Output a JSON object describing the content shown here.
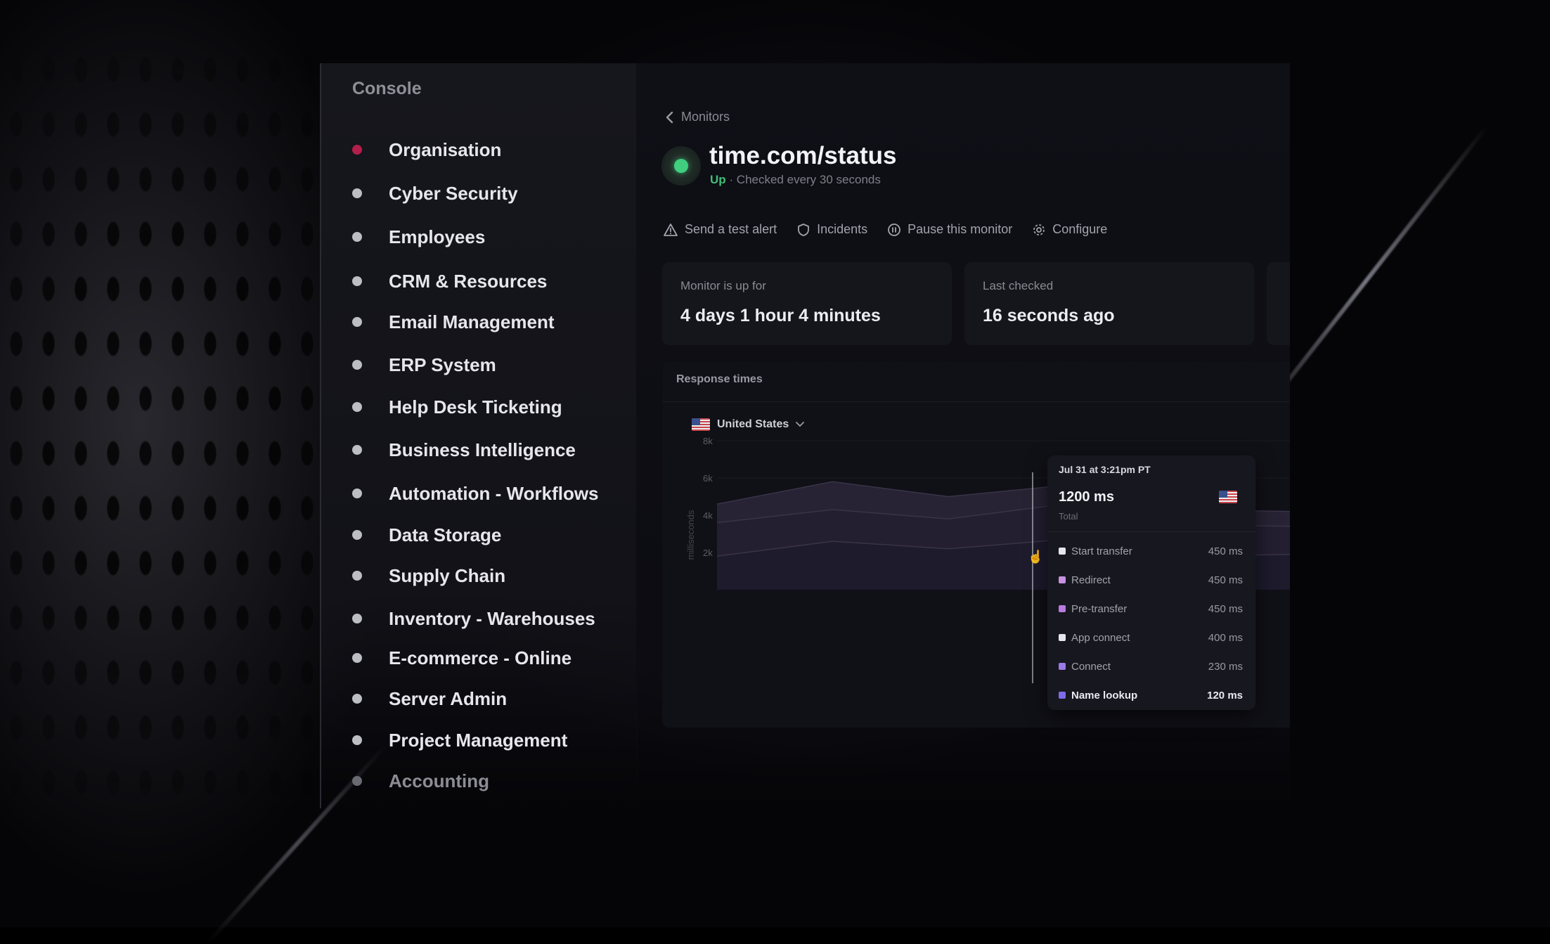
{
  "sidebar": {
    "title": "Console",
    "items": [
      {
        "label": "Organisation",
        "active": true
      },
      {
        "label": "Cyber Security"
      },
      {
        "label": "Employees"
      },
      {
        "label": "CRM & Resources"
      },
      {
        "label": "Email Management"
      },
      {
        "label": "ERP System"
      },
      {
        "label": "Help Desk Ticketing"
      },
      {
        "label": "Business Intelligence"
      },
      {
        "label": "Automation - Workflows"
      },
      {
        "label": "Data Storage"
      },
      {
        "label": "Supply Chain"
      },
      {
        "label": "Inventory - Warehouses"
      },
      {
        "label": "E-commerce - Online"
      },
      {
        "label": "Server Admin"
      },
      {
        "label": "Project Management"
      },
      {
        "label": "Accounting"
      }
    ]
  },
  "monitor": {
    "breadcrumb": "Monitors",
    "title": "time.com/status",
    "status": "Up",
    "status_detail": "· Checked every 30 seconds",
    "status_color": "#3fcf7e",
    "actions": [
      {
        "label": "Send a test alert",
        "icon": "alert-triangle-icon"
      },
      {
        "label": "Incidents",
        "icon": "shield-icon"
      },
      {
        "label": "Pause this monitor",
        "icon": "pause-icon"
      },
      {
        "label": "Configure",
        "icon": "gear-icon"
      }
    ],
    "stats": [
      {
        "label": "Monitor is up for",
        "value": "4 days 1 hour 4 minutes"
      },
      {
        "label": "Last checked",
        "value": "16 seconds ago"
      }
    ]
  },
  "response_times": {
    "title": "Response times",
    "region": "United States",
    "tooltip": {
      "date": "Jul 31 at 3:21pm PT",
      "total": "1200 ms",
      "total_label": "Total",
      "rows": [
        {
          "name": "Start transfer",
          "value": "450 ms",
          "color": "#e6e6ee"
        },
        {
          "name": "Redirect",
          "value": "450 ms",
          "color": "#c792e0"
        },
        {
          "name": "Pre-transfer",
          "value": "450 ms",
          "color": "#b67ae0"
        },
        {
          "name": "App connect",
          "value": "400 ms",
          "color": "#e6e6ee"
        },
        {
          "name": "Connect",
          "value": "230 ms",
          "color": "#9a7ae6"
        },
        {
          "name": "Name lookup",
          "value": "120 ms",
          "color": "#7f6be8"
        }
      ]
    }
  },
  "chart_data": {
    "type": "area",
    "ylabel": "milliseconds",
    "ylim": [
      0,
      8000
    ],
    "yticks": [
      "8k",
      "6k",
      "4k",
      "2k"
    ],
    "grid": true,
    "x": [
      0,
      1,
      2,
      3,
      4,
      5
    ],
    "series": [
      {
        "values": [
          4600,
          5800,
          5000,
          5600,
          4300,
          4200
        ]
      },
      {
        "values": [
          3600,
          4300,
          3800,
          4600,
          3500,
          3400
        ]
      },
      {
        "values": [
          1800,
          2600,
          2200,
          2700,
          1800,
          1900
        ]
      }
    ],
    "colors": [
      "#2a2536",
      "#241f31",
      "#1d1b2c"
    ]
  }
}
